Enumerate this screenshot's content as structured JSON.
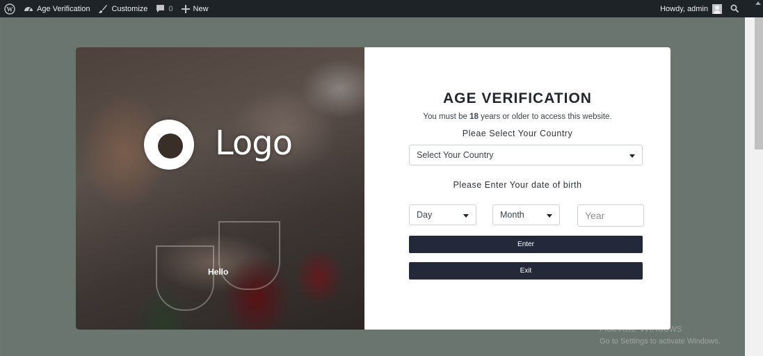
{
  "admin_bar": {
    "site_name": "Age Verification",
    "customize_label": "Customize",
    "comments_count": "0",
    "new_label": "New",
    "greeting": "Howdy, admin"
  },
  "modal": {
    "logo_text": "Logo",
    "hello_text": "Hello",
    "title": "AGE VERIFICATION",
    "subtitle_prefix": "You must be ",
    "min_age": "18",
    "subtitle_suffix": " years or older to access this website.",
    "country_label": "Pleae Select Your Country",
    "country_placeholder": "Select Your Country",
    "dob_label": "Please Enter Your date of birth",
    "day_placeholder": "Day",
    "month_placeholder": "Month",
    "year_placeholder": "Year",
    "enter_label": "Enter",
    "exit_label": "Exit"
  },
  "watermark": {
    "line1": "Activate Windows",
    "line2": "Go to Settings to activate Windows."
  },
  "colors": {
    "admin_bar": "#1d2327",
    "overlay": "#6b7570",
    "button": "#232938"
  }
}
